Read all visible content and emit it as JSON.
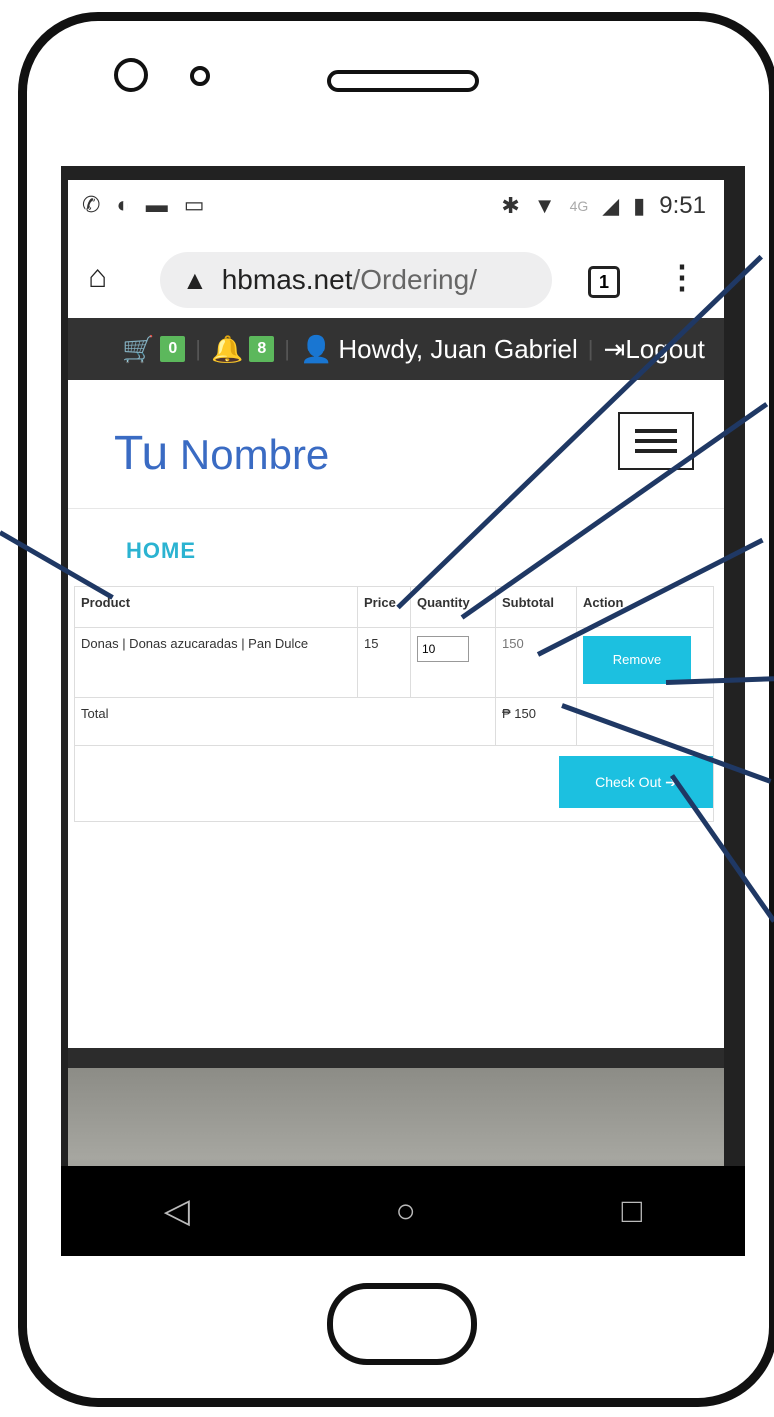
{
  "status_bar": {
    "time": "9:51",
    "network": "4G",
    "left_icons": [
      "whatsapp-icon",
      "signal-audio-icon",
      "image-icon",
      "laptop-icon"
    ],
    "right_icons": [
      "bluetooth-icon",
      "wifi-icon",
      "cell-signal-icon",
      "battery-icon"
    ]
  },
  "browser": {
    "url_domain": "hbmas.net",
    "url_path": "/Ordering/",
    "tab_count": "1"
  },
  "top_nav": {
    "cart_count": "0",
    "notification_count": "8",
    "greeting": "Howdy, Juan Gabriel",
    "logout_label": "Logout"
  },
  "brand": {
    "part1": "Tu",
    "part2": "Nombre"
  },
  "nav": {
    "home_label": "HOME"
  },
  "cart": {
    "headers": [
      "Product",
      "Price",
      "Quantity",
      "Subtotal",
      "Action"
    ],
    "rows": [
      {
        "product": "Donas | Donas azucaradas | Pan Dulce",
        "price": "15",
        "quantity": "10",
        "subtotal": "150",
        "action_label": "Remove"
      }
    ],
    "total_label": "Total",
    "total_value": "₱ 150",
    "checkout_label": "Check Out ➔"
  },
  "colors": {
    "accent": "#1cc0e0",
    "badge": "#5cb85c",
    "brand": "#3a6bc3",
    "topbar": "#333333",
    "annotation": "#1f3864"
  }
}
